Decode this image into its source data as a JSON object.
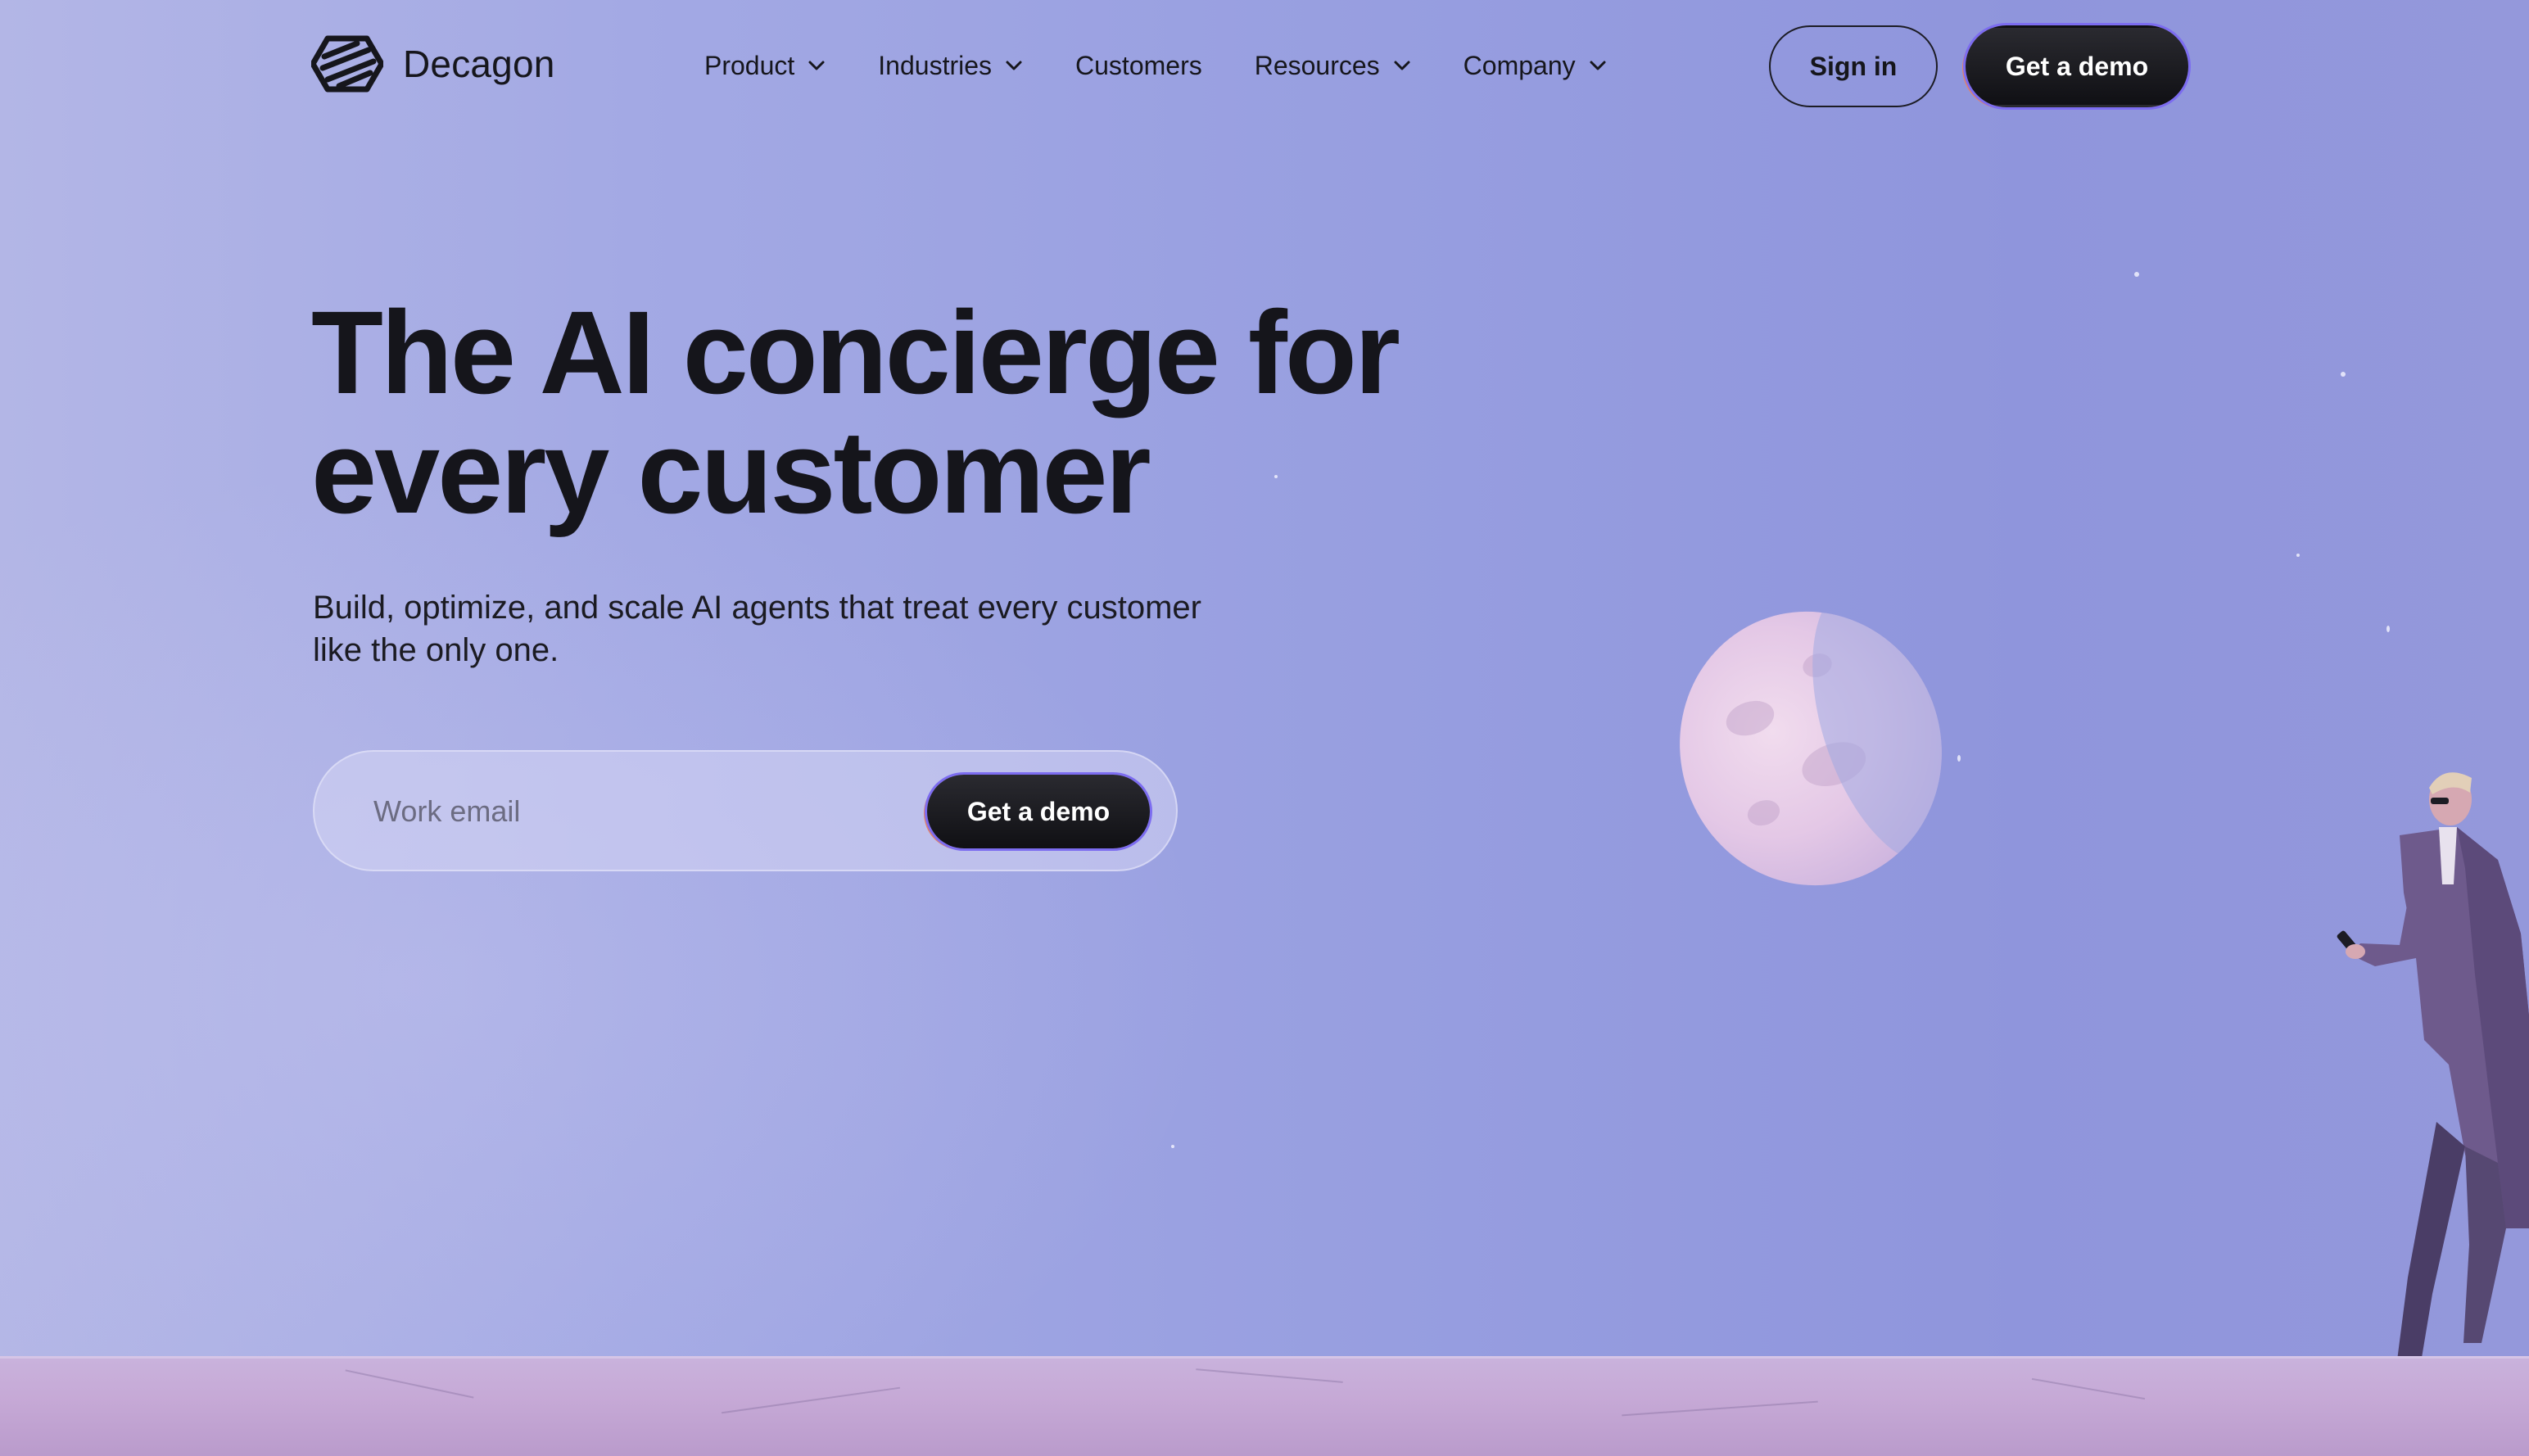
{
  "brand": {
    "name": "Decagon",
    "logo_icon": "decagon-logo-icon"
  },
  "nav": {
    "items": [
      {
        "label": "Product",
        "has_dropdown": true
      },
      {
        "label": "Industries",
        "has_dropdown": true
      },
      {
        "label": "Customers",
        "has_dropdown": false
      },
      {
        "label": "Resources",
        "has_dropdown": true
      },
      {
        "label": "Company",
        "has_dropdown": true
      }
    ],
    "sign_in_label": "Sign in",
    "demo_label": "Get a demo"
  },
  "hero": {
    "title_line1": "The AI concierge for",
    "title_line2": "every customer",
    "subtitle_line1": "Build, optimize, and scale AI agents that treat every customer",
    "subtitle_line2": "like the only one.",
    "email_placeholder": "Work email",
    "email_value": "",
    "cta_label": "Get a demo"
  },
  "colors": {
    "sky": "#979ee0",
    "ground": "#c6a9d6",
    "button_dark": "#16161c",
    "button_border_accent_1": "#7c6cf0",
    "button_border_accent_2": "#e0826a",
    "text_dark": "#15151b"
  }
}
